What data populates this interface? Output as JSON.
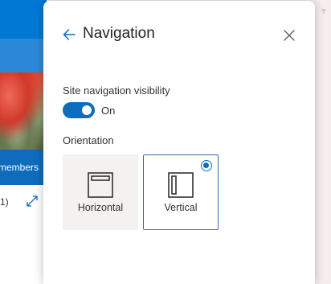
{
  "background": {
    "members_label": "members",
    "count_text": "1)"
  },
  "panel": {
    "title": "Navigation",
    "visibility": {
      "label": "Site navigation visibility",
      "state_text": "On",
      "enabled": true
    },
    "orientation": {
      "label": "Orientation",
      "options": [
        {
          "label": "Horizontal",
          "icon": "horizontal-layout-icon",
          "selected": false
        },
        {
          "label": "Vertical",
          "icon": "vertical-layout-icon",
          "selected": true
        }
      ]
    }
  },
  "colors": {
    "accent": "#0f6cbd",
    "suite_bar": "#0078d4",
    "tile_background": "#f3f2f1",
    "text": "#323130"
  }
}
